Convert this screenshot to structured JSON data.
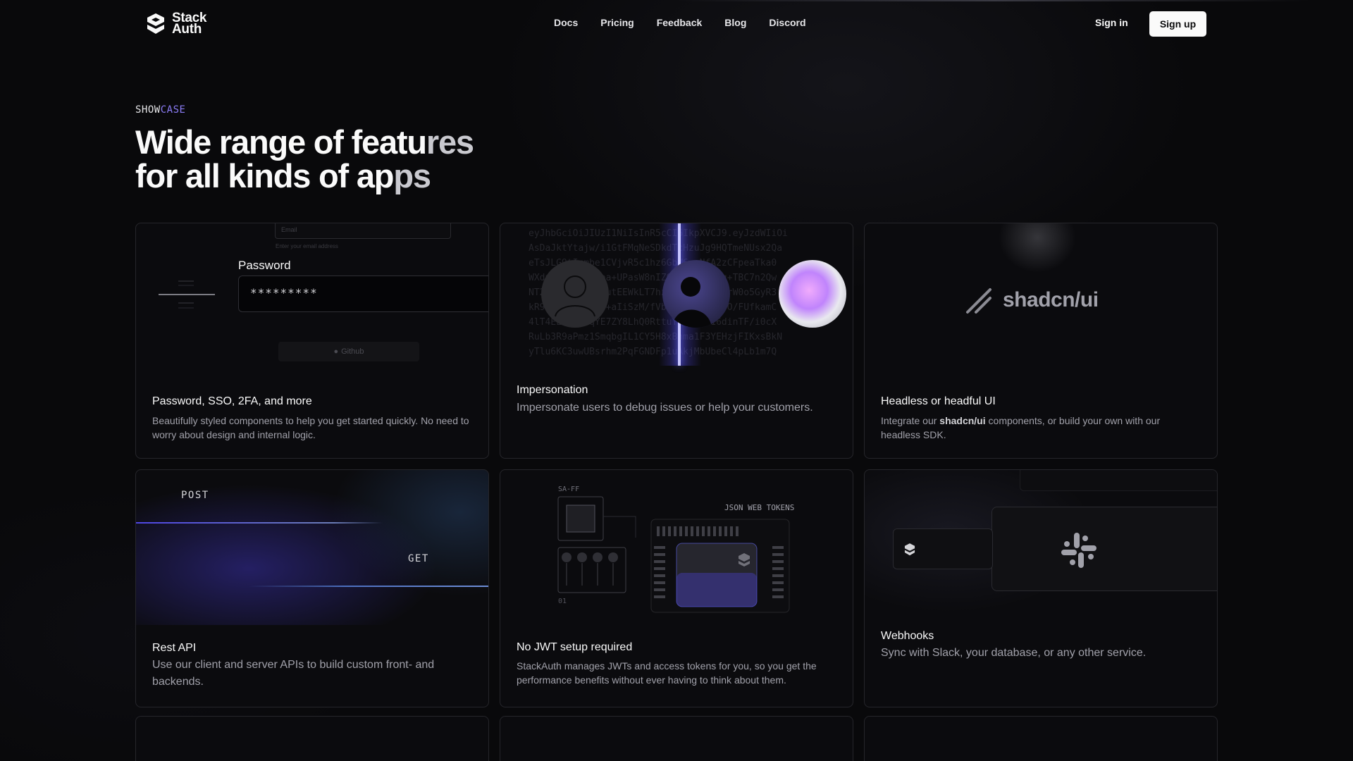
{
  "nav": {
    "logo_line1": "Stack",
    "logo_line2": "Auth",
    "links": [
      "Docs",
      "Pricing",
      "Feedback",
      "Blog",
      "Discord"
    ],
    "signin": "Sign in",
    "signup": "Sign up"
  },
  "header": {
    "eyebrow_a": "SHOW",
    "eyebrow_b": "CASE",
    "headline_1a": "Wide range of featu",
    "headline_1b": "res",
    "headline_2a": "for all kinds of ap",
    "headline_2b": "ps"
  },
  "cards": [
    {
      "title": "Password, SSO, 2FA, and more",
      "desc": "Beautifully styled components to help you get started quickly. No need to worry about design and internal logic.",
      "email_placeholder": "Email",
      "email_hint": "Enter your email address",
      "pw_label": "Password",
      "pw_value": "*********",
      "github_label": "Github"
    },
    {
      "title": "Impersonation",
      "desc": "Impersonate users to debug issues or help your customers.",
      "code_lines": [
        "eyJhbGciOiJIUzI1NiIsInR5cCI6IkpXVCJ9.eyJzdWIiOi",
        "AsDaJktYtajw/i1GtFMqNeSDkdTcHzuJg9HQTmeNUsx2Qa",
        "eTsJLG9tIcmbe1CVjvR5c1hz6GbM6wzNfA2zCFpeaTka0",
        "WXdpyGPv+1Z0+ba+UPasW8nIZOOVsaCOJ9cg+TBC7n2Qw",
        "NT2T9pDsYq3HAPutEEWkLT7hzQdxl3iBS/HJrW0o5GyR3",
        "kR9wTVbYQFpQzV+aIiSzM/fVbUNnWM4GSbB5O/FUfkamC",
        "4lT4EL7uJ61qYE7ZY8LhQ0RttuYnq/Y/716dinTF/i0cX",
        "RuLb3R9aPmz1SmqbgIL1CY5H8xBnma1F3YEHzjFIKxsBkN",
        "yTlu6KC3uwUBsrhm2PqFGNDFp1uAkjMbUbeCl4pLb1m7Q"
      ]
    },
    {
      "title": "Headless or headful UI",
      "desc_pre": "Integrate our ",
      "desc_bold": "shadcn/ui",
      "desc_post": " components, or build your own with our headless SDK.",
      "brand": "shadcn/ui"
    },
    {
      "title": "Rest API",
      "desc": "Use our client and server APIs to build custom front- and backends.",
      "post_label": "POST",
      "get_label": "GET"
    },
    {
      "title": "No JWT setup required",
      "desc": "StackAuth manages JWTs and access tokens for you, so you get the performance benefits without ever having to think about them.",
      "chip_label": "SA-FF",
      "jwt_label": "JSON WEB TOKENS",
      "chip_num": "01"
    },
    {
      "title": "Webhooks",
      "desc": "Sync with Slack, your database, or any other service."
    }
  ],
  "colors": {
    "background": "#09090b",
    "accent_purple": "#8b7cf6",
    "beam_blue": "#4f46e5",
    "card_border": "#26262b"
  }
}
